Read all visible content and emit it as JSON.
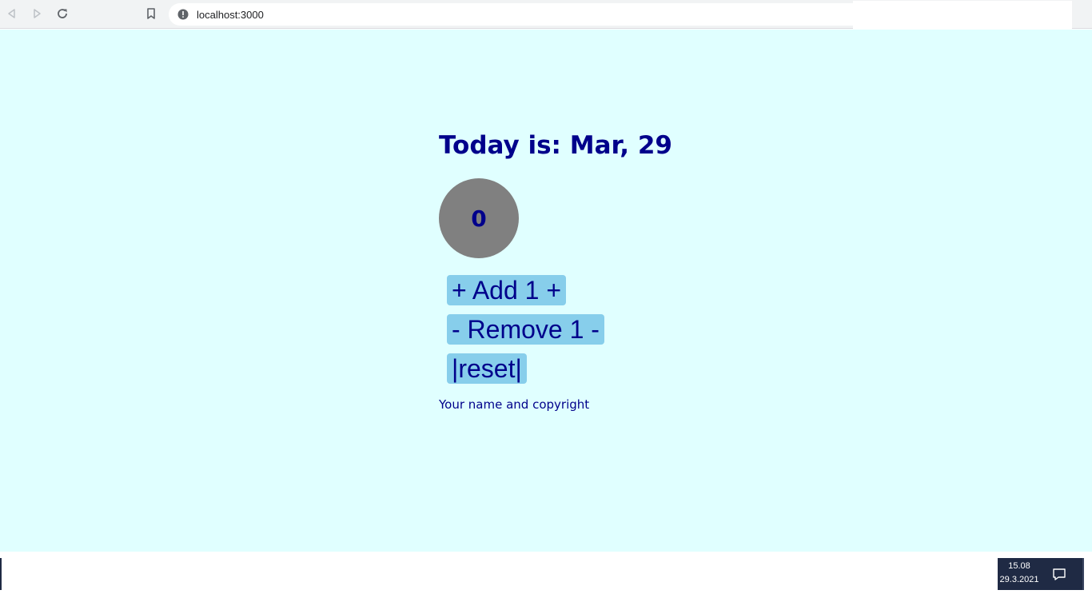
{
  "browser": {
    "url": "localhost:3000",
    "back_icon": "back-arrow-icon",
    "forward_icon": "forward-arrow-icon",
    "reload_icon": "reload-icon",
    "bookmark_icon": "bookmark-icon",
    "site_info_icon": "info-icon"
  },
  "page": {
    "title": "Today is: Mar, 29",
    "counter_value": "0",
    "buttons": {
      "add_label": "+ Add 1 +",
      "remove_label": "- Remove 1 -",
      "reset_label": "|reset|"
    },
    "footer": "Your name and copyright"
  },
  "colors": {
    "background": "#e0ffff",
    "text": "#00008b",
    "button_bg": "#87ceeb",
    "circle": "#808080"
  },
  "taskbar": {
    "time": "15.08",
    "date": "29.3.2021",
    "notification_icon": "notification-icon"
  }
}
